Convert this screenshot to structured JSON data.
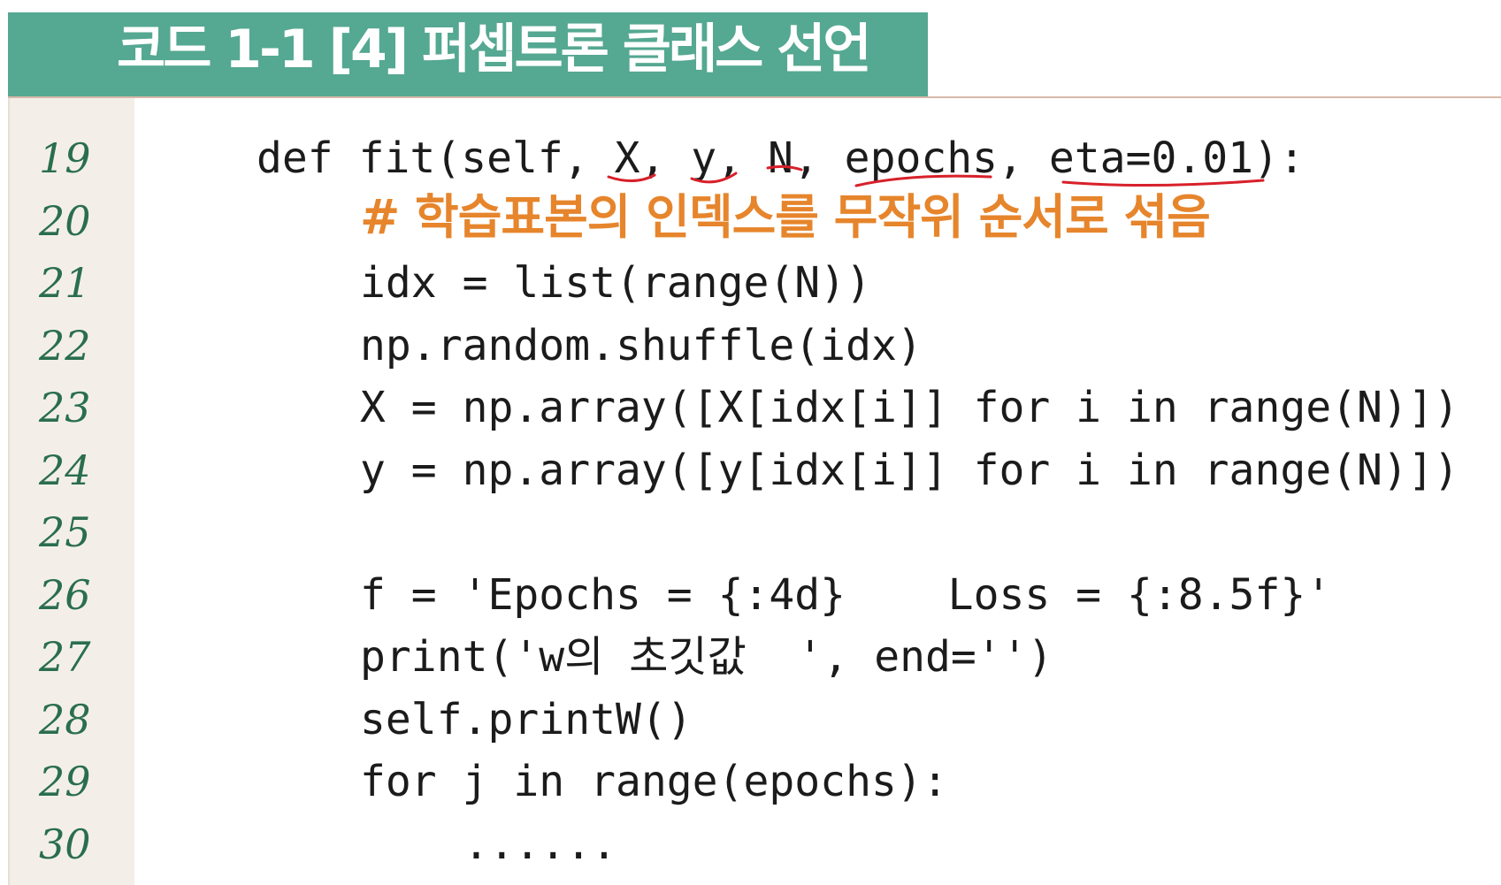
{
  "title": "코드 1-1 [4] 퍼셉트론 클래스 선언",
  "colors": {
    "title_bar": "#55a891",
    "line_number": "#2a6e4d",
    "comment": "#e6852c",
    "annotation": "#d8202a"
  },
  "code": [
    {
      "num": "19",
      "text": "def fit(self, X, y, N, epochs, eta=0.01):",
      "indent": 0
    },
    {
      "num": "20",
      "text": "# 학습표본의 인덱스를 무작위 순서로 섞음",
      "indent": 1,
      "comment": true
    },
    {
      "num": "21",
      "text": "idx = list(range(N))",
      "indent": 1
    },
    {
      "num": "22",
      "text": "np.random.shuffle(idx)",
      "indent": 1
    },
    {
      "num": "23",
      "text": "X = np.array([X[idx[i]] for i in range(N)])",
      "indent": 1
    },
    {
      "num": "24",
      "text": "y = np.array([y[idx[i]] for i in range(N)])",
      "indent": 1
    },
    {
      "num": "25",
      "text": "",
      "indent": 1
    },
    {
      "num": "26",
      "text": "f = 'Epochs = {:4d}    Loss = {:8.5f}'",
      "indent": 1
    },
    {
      "num": "27",
      "text": "print('w의 초깃값  ', end='')",
      "indent": 1
    },
    {
      "num": "28",
      "text": "self.printW()",
      "indent": 1
    },
    {
      "num": "29",
      "text": "for j in range(epochs):",
      "indent": 1
    },
    {
      "num": "30",
      "text": "......",
      "indent": 2
    }
  ]
}
